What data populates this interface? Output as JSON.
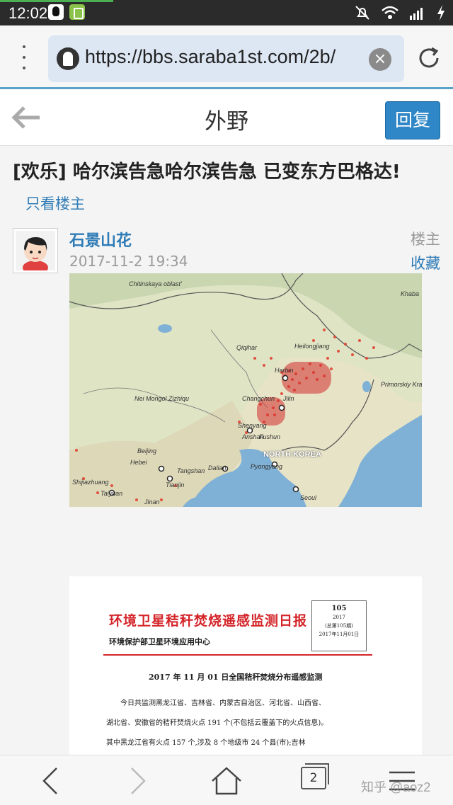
{
  "status_bar": {
    "time": "12:02"
  },
  "browser": {
    "url": "https://bbs.saraba1st.com/2b/",
    "clear_label": "×"
  },
  "header": {
    "title": "外野",
    "reply_label": "回复"
  },
  "thread": {
    "title": "[欢乐] 哈尔滨告急哈尔滨告急 已变东方巴格达!",
    "only_op_label": "只看楼主"
  },
  "post": {
    "author": "石景山花",
    "time": "2017-11-2 19:34",
    "floor_label": "楼主",
    "favorite_label": "收藏"
  },
  "map_image": {
    "labels": {
      "chita": "Chitinskaya oblast'",
      "heilongjiang": "Heilongjiang",
      "qiqihar": "Qiqihar",
      "harbin": "Harbin",
      "jilin": "Jilin",
      "changchun": "Changchun",
      "nei_monggol": "Nei Mongol Zizhiqu",
      "primorskiy": "Primorskiy Kray",
      "khabarovsk": "Khaba",
      "shenyang": "Shenyang",
      "anshan": "Anshan",
      "fushun": "Fushun",
      "north_korea": "NORTH KOREA",
      "beijing": "Beijing",
      "hebei": "Hebei",
      "tangshan": "Tangshan",
      "dalian": "Dalian",
      "tianjin": "Tianjin",
      "pyongyang": "Pyongyang",
      "shijiazhuang": "Shijiazhuang",
      "taiyuan": "Taiyuan",
      "jinan": "Jinan",
      "seoul": "Seoul"
    }
  },
  "document_image": {
    "title": "环境卫星秸秆焚烧遥感监测日报",
    "org": "环境保护部卫星环境应用中心",
    "issue_number": "105",
    "year": "2017",
    "total_issue": "(总第105期)",
    "date": "2017年11月01日",
    "subtitle": "2017 年 11 月 01 日全国秸秆焚烧分布遥感监测",
    "body_lines": [
      "今日共监测黑龙江省、吉林省、内蒙古自治区、河北省、山西省、",
      "湖北省、安徽省的秸秆焚烧火点 191 个(不包括云覆盖下的火点信息)。",
      "其中黑龙江省有火点 157 个,涉及 8 个地级市 24 个县(市);吉林"
    ]
  },
  "bottom_nav": {
    "tab_count": "2"
  },
  "watermark": "知乎 @aoz2"
}
